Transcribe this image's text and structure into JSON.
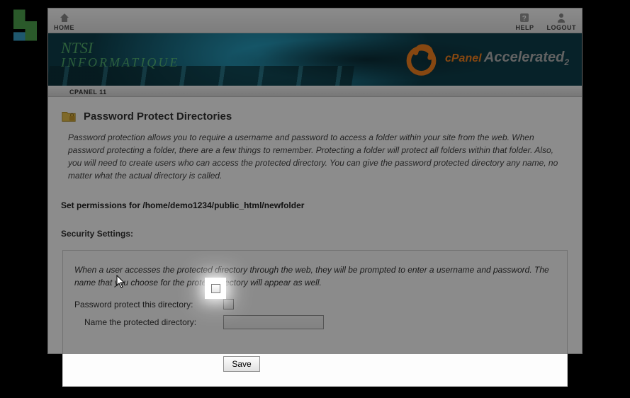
{
  "top": {
    "home": "HOME",
    "help": "HELP",
    "logout": "LOGOUT"
  },
  "banner": {
    "line1": "NTSI",
    "line2": "INFORMATIQUE",
    "cpanel": "cPanel",
    "accel": "Accelerated",
    "sub": "2"
  },
  "breadcrumb": "CPANEL 11",
  "page": {
    "title": "Password Protect Directories",
    "description": "Password protection allows you to require a username and password to access a folder within your site from the web. When password protecting a folder, there are a few things to remember. Protecting a folder will protect all folders within that folder. Also, you will need to create users who can access the protected directory. You can give the password protected directory any name, no matter what the actual directory is called.",
    "permissions_prefix": "Set permissions for ",
    "permissions_path": "/home/demo1234/public_html/newfolder",
    "security_heading": "Security Settings:"
  },
  "security": {
    "desc": "When a user accesses the protected directory through the web, they will be prompted to enter a username and password. The name that you choose for the protect directory will appear as well.",
    "checkbox_label": "Password protect this directory:",
    "name_label": "Name the protected directory:",
    "name_value": "",
    "save": "Save"
  },
  "colors": {
    "accent_orange": "#f58220",
    "banner_teal": "#0b3a46",
    "text_green": "#6fdc7a"
  }
}
